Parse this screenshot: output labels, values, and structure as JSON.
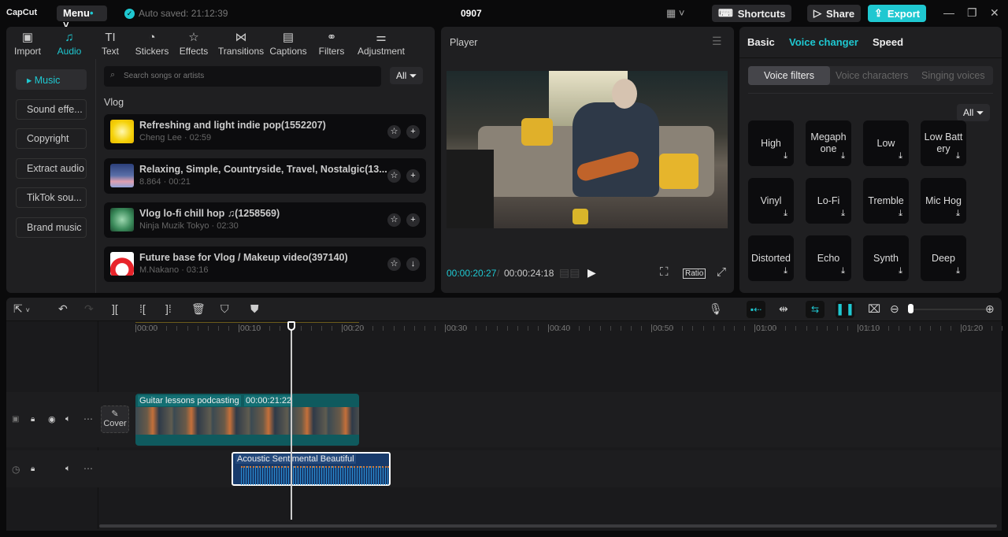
{
  "app": {
    "logo": "CapCut",
    "menu": "Menu",
    "autosave": "Auto saved: 21:12:39",
    "project_title": "0907",
    "shortcuts": "Shortcuts",
    "share": "Share",
    "export": "Export",
    "accent": "#1fc8d1"
  },
  "tabs": [
    {
      "label": "Import",
      "icon": "import-icon"
    },
    {
      "label": "Audio",
      "icon": "audio-icon"
    },
    {
      "label": "Text",
      "icon": "text-icon"
    },
    {
      "label": "Stickers",
      "icon": "sticker-icon"
    },
    {
      "label": "Effects",
      "icon": "effects-icon"
    },
    {
      "label": "Transitions",
      "icon": "transitions-icon"
    },
    {
      "label": "Captions",
      "icon": "captions-icon"
    },
    {
      "label": "Filters",
      "icon": "filters-icon"
    },
    {
      "label": "Adjustment",
      "icon": "adjustment-icon"
    }
  ],
  "sidebar": [
    "Music",
    "Sound effe...",
    "Copyright",
    "Extract audio",
    "TikTok sou...",
    "Brand music"
  ],
  "library": {
    "search_placeholder": "Search songs or artists",
    "filter": "All",
    "section": "Vlog",
    "songs": [
      {
        "title": "Refreshing and light indie pop(1552207)",
        "meta": "Cheng Lee · 02:59",
        "action": "+"
      },
      {
        "title": "Relaxing, Simple, Countryside, Travel, Nostalgic(13...",
        "meta": "8.864 · 00:21",
        "action": "+"
      },
      {
        "title": "Vlog  lo-fi chill hop ♫(1258569)",
        "meta": "Ninja Muzik Tokyo · 02:30",
        "action": "+"
      },
      {
        "title": "Future base for Vlog / Makeup video(397140)",
        "meta": "M.Nakano · 03:16",
        "action": "↓"
      }
    ]
  },
  "player": {
    "title": "Player",
    "current": "00:00:20:27",
    "total": "00:00:24:18",
    "ratio": "Ratio"
  },
  "right": {
    "tabs": [
      "Basic",
      "Voice changer",
      "Speed"
    ],
    "subtabs": [
      "Voice filters",
      "Voice characters",
      "Singing voices"
    ],
    "filter": "All",
    "filters": [
      "High",
      "Megaphone",
      "Low",
      "Low Battery",
      "Vinyl",
      "Lo-Fi",
      "Tremble",
      "Mic Hog",
      "Distorted",
      "Echo",
      "Synth",
      "Deep"
    ]
  },
  "timeline": {
    "ruler": [
      "00:00",
      "00:10",
      "00:20",
      "00:30",
      "00:40",
      "00:50",
      "01:00",
      "01:10",
      "01:20"
    ],
    "cover": "Cover",
    "video_clip": {
      "name": "Guitar lessons podcasting",
      "duration": "00:00:21:22"
    },
    "audio_clip": {
      "name": "Acoustic Sentimental Beautiful"
    }
  }
}
